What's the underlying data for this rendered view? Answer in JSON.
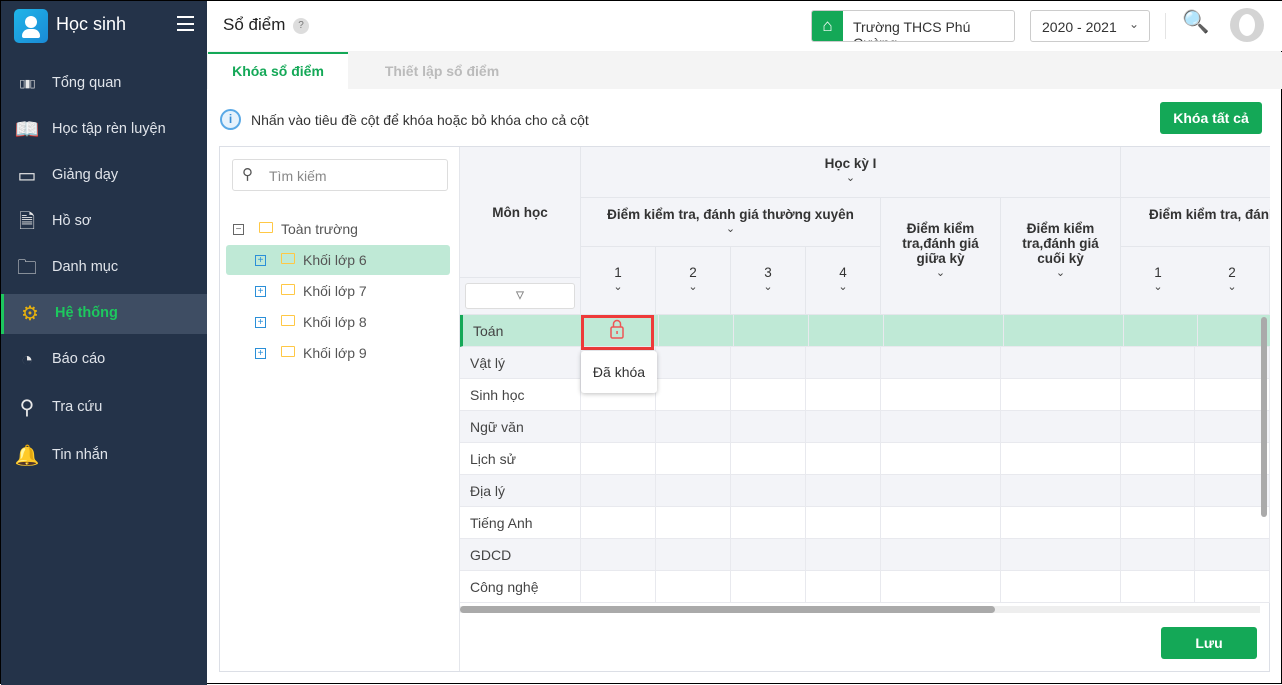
{
  "app": {
    "title": "Học sinh"
  },
  "sidebar": {
    "items": [
      {
        "label": "Tổng quan",
        "icon": "bar-chart-icon"
      },
      {
        "label": "Học tập rèn luyện",
        "icon": "book-icon"
      },
      {
        "label": "Giảng dạy",
        "icon": "board-icon"
      },
      {
        "label": "Hồ sơ",
        "icon": "document-icon"
      },
      {
        "label": "Danh mục",
        "icon": "folder-icon"
      },
      {
        "label": "Hệ thống",
        "icon": "gear-icon",
        "active": true
      },
      {
        "label": "Báo cáo",
        "icon": "pie-chart-icon"
      },
      {
        "label": "Tra cứu",
        "icon": "search-icon"
      },
      {
        "label": "Tin nhắn",
        "icon": "bell-icon"
      }
    ]
  },
  "header": {
    "title": "Sổ điểm",
    "help": "?",
    "school": "Trường THCS Phú Cường",
    "year": "2020 - 2021"
  },
  "tabs": [
    "Khóa sổ điểm",
    "Thiết lập sổ điểm"
  ],
  "info": "Nhấn vào tiêu đề cột để khóa hoặc bỏ khóa cho cả cột",
  "buttons": {
    "lock_all": "Khóa tất cả",
    "save": "Lưu"
  },
  "tree": {
    "search_placeholder": "Tìm kiếm",
    "root": "Toàn trường",
    "children": [
      "Khối lớp 6",
      "Khối lớp 7",
      "Khối lớp 8",
      "Khối lớp 9"
    ]
  },
  "grid": {
    "subject_header": "Môn học",
    "semester": "Học kỳ I",
    "regular": "Điểm kiểm tra, đánh giá thường xuyên",
    "regular_cols": [
      "1",
      "2",
      "3",
      "4"
    ],
    "midterm": "Điểm kiểm tra,đánh giá giữa kỳ",
    "final": "Điểm kiểm tra,đánh giá cuối kỳ",
    "regular2": "Điểm kiểm tra, đánh giá thường xuyên",
    "regular2_cols": [
      "1",
      "2"
    ],
    "subjects": [
      "Toán",
      "Vật lý",
      "Sinh học",
      "Ngữ văn",
      "Lịch sử",
      "Địa lý",
      "Tiếng Anh",
      "GDCD",
      "Công nghệ"
    ],
    "tooltip": "Đã khóa"
  },
  "colors": {
    "accent": "#14a857",
    "sidebar": "#243349",
    "selected": "#bfe9d6",
    "lock": "#ee3a3a"
  }
}
